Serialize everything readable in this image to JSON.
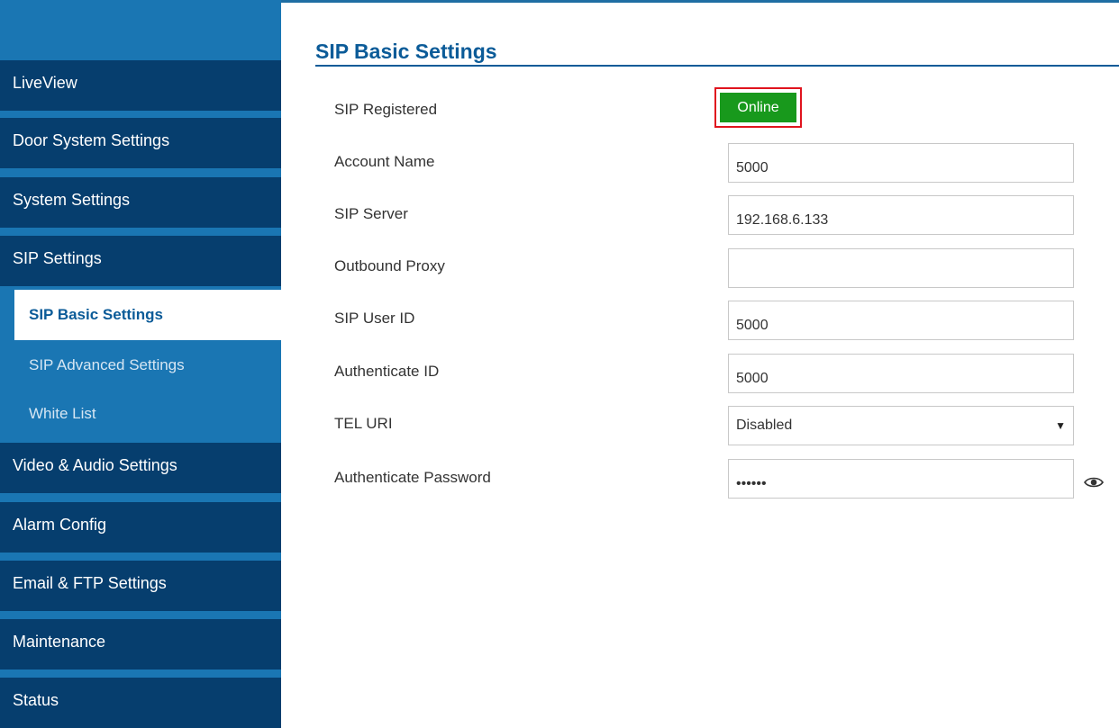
{
  "sidebar": {
    "items": [
      {
        "label": "LiveView"
      },
      {
        "label": "Door System Settings"
      },
      {
        "label": "System Settings"
      },
      {
        "label": "SIP Settings"
      }
    ],
    "sub_items": [
      {
        "label": "SIP Basic Settings",
        "active": true
      },
      {
        "label": "SIP Advanced Settings"
      },
      {
        "label": "White List"
      }
    ],
    "items_after": [
      {
        "label": "Video & Audio Settings"
      },
      {
        "label": "Alarm Config"
      },
      {
        "label": "Email & FTP Settings"
      },
      {
        "label": "Maintenance"
      },
      {
        "label": "Status"
      }
    ]
  },
  "page": {
    "title": "SIP Basic Settings"
  },
  "form": {
    "sip_registered": {
      "label": "SIP Registered",
      "status": "Online",
      "status_color": "#18991c"
    },
    "account_name": {
      "label": "Account Name",
      "value": "5000"
    },
    "sip_server": {
      "label": "SIP Server",
      "value": "192.168.6.133"
    },
    "outbound_proxy": {
      "label": "Outbound Proxy",
      "value": ""
    },
    "sip_user_id": {
      "label": "SIP User ID",
      "value": "5000"
    },
    "authenticate_id": {
      "label": "Authenticate ID",
      "value": "5000"
    },
    "tel_uri": {
      "label": "TEL URI",
      "value": "Disabled"
    },
    "authenticate_password": {
      "label": "Authenticate Password",
      "value": "••••••"
    }
  },
  "icons": {
    "select_arrow": "chevron-down-icon",
    "show_password": "eye-icon"
  },
  "colors": {
    "accent": "#0b5b98",
    "nav_dark": "#063e6e",
    "nav_light": "#1a76b3",
    "highlight_border": "#e0141e"
  }
}
